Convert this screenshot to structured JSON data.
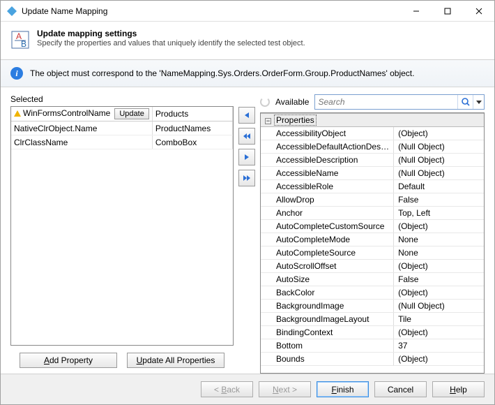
{
  "window": {
    "title": "Update Name Mapping"
  },
  "header": {
    "title": "Update mapping settings",
    "subtitle": "Specify the properties and values that uniquely identify the selected test object."
  },
  "info": {
    "text": "The object must correspond to the 'NameMapping.Sys.Orders.OrderForm.Group.ProductNames' object."
  },
  "selected": {
    "label": "Selected",
    "update_button": "Update",
    "rows": [
      {
        "name": "WinFormsControlName",
        "value": "Products",
        "warn": true,
        "update": true
      },
      {
        "name": "NativeClrObject.Name",
        "value": "ProductNames",
        "warn": false,
        "update": false
      },
      {
        "name": "ClrClassName",
        "value": "ComboBox",
        "warn": false,
        "update": false
      }
    ]
  },
  "available": {
    "label": "Available",
    "group": "Properties",
    "rows": [
      {
        "name": "AccessibilityObject",
        "value": "(Object)"
      },
      {
        "name": "AccessibleDefaultActionDes…",
        "value": "(Null Object)"
      },
      {
        "name": "AccessibleDescription",
        "value": "(Null Object)"
      },
      {
        "name": "AccessibleName",
        "value": "(Null Object)"
      },
      {
        "name": "AccessibleRole",
        "value": "Default"
      },
      {
        "name": "AllowDrop",
        "value": "False"
      },
      {
        "name": "Anchor",
        "value": "Top, Left"
      },
      {
        "name": "AutoCompleteCustomSource",
        "value": "(Object)"
      },
      {
        "name": "AutoCompleteMode",
        "value": "None"
      },
      {
        "name": "AutoCompleteSource",
        "value": "None"
      },
      {
        "name": "AutoScrollOffset",
        "value": "(Object)"
      },
      {
        "name": "AutoSize",
        "value": "False"
      },
      {
        "name": "BackColor",
        "value": "(Object)"
      },
      {
        "name": "BackgroundImage",
        "value": "(Null Object)"
      },
      {
        "name": "BackgroundImageLayout",
        "value": "Tile"
      },
      {
        "name": "BindingContext",
        "value": "(Object)"
      },
      {
        "name": "Bottom",
        "value": "37"
      },
      {
        "name": "Bounds",
        "value": "(Object)"
      }
    ]
  },
  "search": {
    "placeholder": "Search"
  },
  "buttons": {
    "add_property": "Add Property",
    "update_all": "Update All Properties",
    "back": "< Back",
    "next": "Next >",
    "finish": "Finish",
    "cancel": "Cancel",
    "help": "Help"
  }
}
